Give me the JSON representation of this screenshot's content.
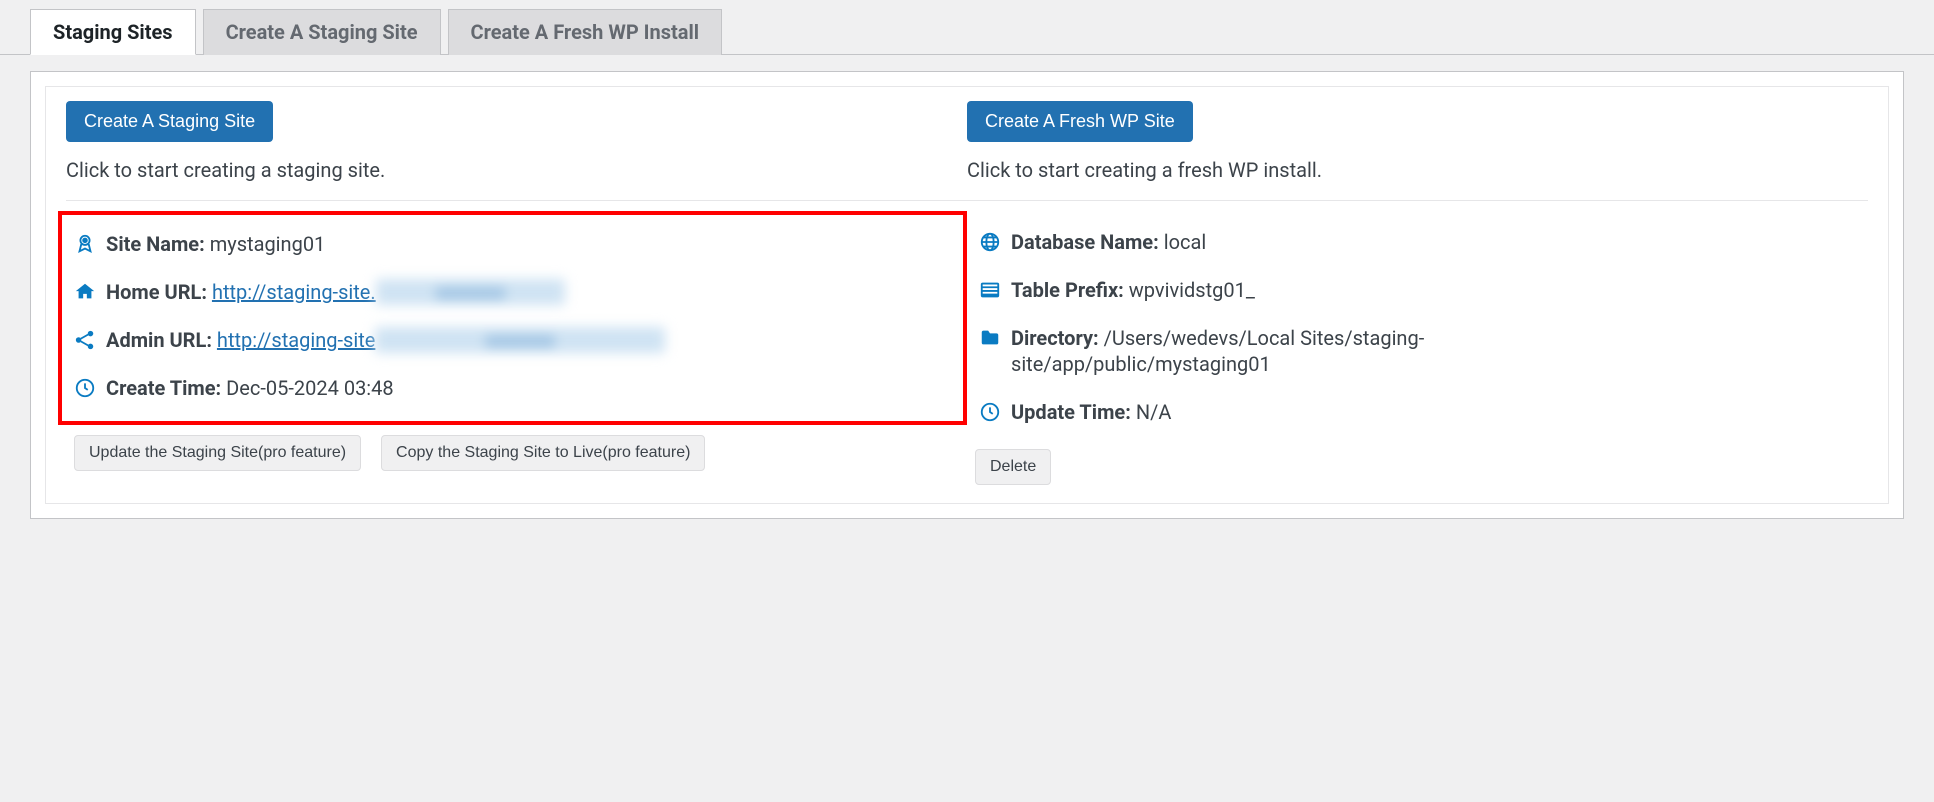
{
  "tabs": {
    "staging_sites": "Staging Sites",
    "create_staging": "Create A Staging Site",
    "create_fresh": "Create A Fresh WP Install"
  },
  "buttons": {
    "create_staging": "Create A Staging Site",
    "create_fresh": "Create A Fresh WP Site",
    "update_staging": "Update the Staging Site(pro feature)",
    "copy_to_live": "Copy the Staging Site to Live(pro feature)",
    "delete": "Delete"
  },
  "helpers": {
    "staging": "Click to start creating a staging site.",
    "fresh": "Click to start creating a fresh WP install."
  },
  "left": {
    "site_name_label": "Site Name:",
    "site_name_value": "mystaging01",
    "home_url_label": "Home URL:",
    "home_url_value": "http://staging-site.",
    "admin_url_label": "Admin URL:",
    "admin_url_value": "http://staging-site",
    "create_time_label": "Create Time:",
    "create_time_value": "Dec-05-2024 03:48"
  },
  "right": {
    "db_name_label": "Database Name:",
    "db_name_value": "local",
    "table_prefix_label": "Table Prefix:",
    "table_prefix_value": "wpvividstg01_",
    "directory_label": "Directory:",
    "directory_value": "/Users/wedevs/Local Sites/staging-site/app/public/mystaging01",
    "update_time_label": "Update Time:",
    "update_time_value": "N/A"
  }
}
